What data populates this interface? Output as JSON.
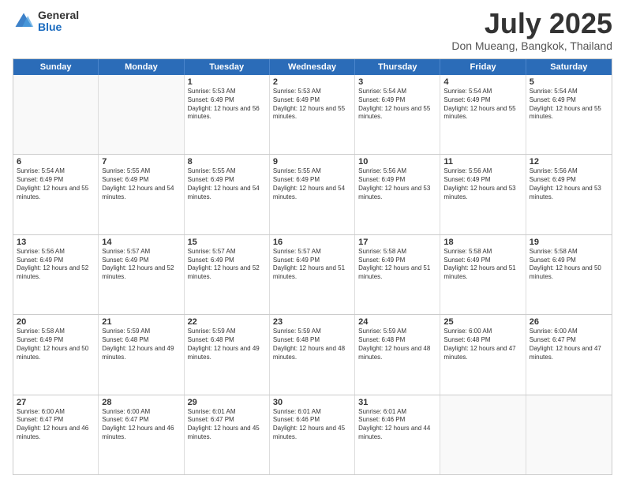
{
  "header": {
    "logo_general": "General",
    "logo_blue": "Blue",
    "month_title": "July 2025",
    "location": "Don Mueang, Bangkok, Thailand"
  },
  "days_of_week": [
    "Sunday",
    "Monday",
    "Tuesday",
    "Wednesday",
    "Thursday",
    "Friday",
    "Saturday"
  ],
  "weeks": [
    [
      {
        "day": "",
        "empty": true
      },
      {
        "day": "",
        "empty": true
      },
      {
        "day": "1",
        "sunrise": "5:53 AM",
        "sunset": "6:49 PM",
        "daylight": "12 hours and 56 minutes."
      },
      {
        "day": "2",
        "sunrise": "5:53 AM",
        "sunset": "6:49 PM",
        "daylight": "12 hours and 55 minutes."
      },
      {
        "day": "3",
        "sunrise": "5:54 AM",
        "sunset": "6:49 PM",
        "daylight": "12 hours and 55 minutes."
      },
      {
        "day": "4",
        "sunrise": "5:54 AM",
        "sunset": "6:49 PM",
        "daylight": "12 hours and 55 minutes."
      },
      {
        "day": "5",
        "sunrise": "5:54 AM",
        "sunset": "6:49 PM",
        "daylight": "12 hours and 55 minutes."
      }
    ],
    [
      {
        "day": "6",
        "sunrise": "5:54 AM",
        "sunset": "6:49 PM",
        "daylight": "12 hours and 55 minutes."
      },
      {
        "day": "7",
        "sunrise": "5:55 AM",
        "sunset": "6:49 PM",
        "daylight": "12 hours and 54 minutes."
      },
      {
        "day": "8",
        "sunrise": "5:55 AM",
        "sunset": "6:49 PM",
        "daylight": "12 hours and 54 minutes."
      },
      {
        "day": "9",
        "sunrise": "5:55 AM",
        "sunset": "6:49 PM",
        "daylight": "12 hours and 54 minutes."
      },
      {
        "day": "10",
        "sunrise": "5:56 AM",
        "sunset": "6:49 PM",
        "daylight": "12 hours and 53 minutes."
      },
      {
        "day": "11",
        "sunrise": "5:56 AM",
        "sunset": "6:49 PM",
        "daylight": "12 hours and 53 minutes."
      },
      {
        "day": "12",
        "sunrise": "5:56 AM",
        "sunset": "6:49 PM",
        "daylight": "12 hours and 53 minutes."
      }
    ],
    [
      {
        "day": "13",
        "sunrise": "5:56 AM",
        "sunset": "6:49 PM",
        "daylight": "12 hours and 52 minutes."
      },
      {
        "day": "14",
        "sunrise": "5:57 AM",
        "sunset": "6:49 PM",
        "daylight": "12 hours and 52 minutes."
      },
      {
        "day": "15",
        "sunrise": "5:57 AM",
        "sunset": "6:49 PM",
        "daylight": "12 hours and 52 minutes."
      },
      {
        "day": "16",
        "sunrise": "5:57 AM",
        "sunset": "6:49 PM",
        "daylight": "12 hours and 51 minutes."
      },
      {
        "day": "17",
        "sunrise": "5:58 AM",
        "sunset": "6:49 PM",
        "daylight": "12 hours and 51 minutes."
      },
      {
        "day": "18",
        "sunrise": "5:58 AM",
        "sunset": "6:49 PM",
        "daylight": "12 hours and 51 minutes."
      },
      {
        "day": "19",
        "sunrise": "5:58 AM",
        "sunset": "6:49 PM",
        "daylight": "12 hours and 50 minutes."
      }
    ],
    [
      {
        "day": "20",
        "sunrise": "5:58 AM",
        "sunset": "6:49 PM",
        "daylight": "12 hours and 50 minutes."
      },
      {
        "day": "21",
        "sunrise": "5:59 AM",
        "sunset": "6:48 PM",
        "daylight": "12 hours and 49 minutes."
      },
      {
        "day": "22",
        "sunrise": "5:59 AM",
        "sunset": "6:48 PM",
        "daylight": "12 hours and 49 minutes."
      },
      {
        "day": "23",
        "sunrise": "5:59 AM",
        "sunset": "6:48 PM",
        "daylight": "12 hours and 48 minutes."
      },
      {
        "day": "24",
        "sunrise": "5:59 AM",
        "sunset": "6:48 PM",
        "daylight": "12 hours and 48 minutes."
      },
      {
        "day": "25",
        "sunrise": "6:00 AM",
        "sunset": "6:48 PM",
        "daylight": "12 hours and 47 minutes."
      },
      {
        "day": "26",
        "sunrise": "6:00 AM",
        "sunset": "6:47 PM",
        "daylight": "12 hours and 47 minutes."
      }
    ],
    [
      {
        "day": "27",
        "sunrise": "6:00 AM",
        "sunset": "6:47 PM",
        "daylight": "12 hours and 46 minutes."
      },
      {
        "day": "28",
        "sunrise": "6:00 AM",
        "sunset": "6:47 PM",
        "daylight": "12 hours and 46 minutes."
      },
      {
        "day": "29",
        "sunrise": "6:01 AM",
        "sunset": "6:47 PM",
        "daylight": "12 hours and 45 minutes."
      },
      {
        "day": "30",
        "sunrise": "6:01 AM",
        "sunset": "6:46 PM",
        "daylight": "12 hours and 45 minutes."
      },
      {
        "day": "31",
        "sunrise": "6:01 AM",
        "sunset": "6:46 PM",
        "daylight": "12 hours and 44 minutes."
      },
      {
        "day": "",
        "empty": true
      },
      {
        "day": "",
        "empty": true
      }
    ]
  ]
}
